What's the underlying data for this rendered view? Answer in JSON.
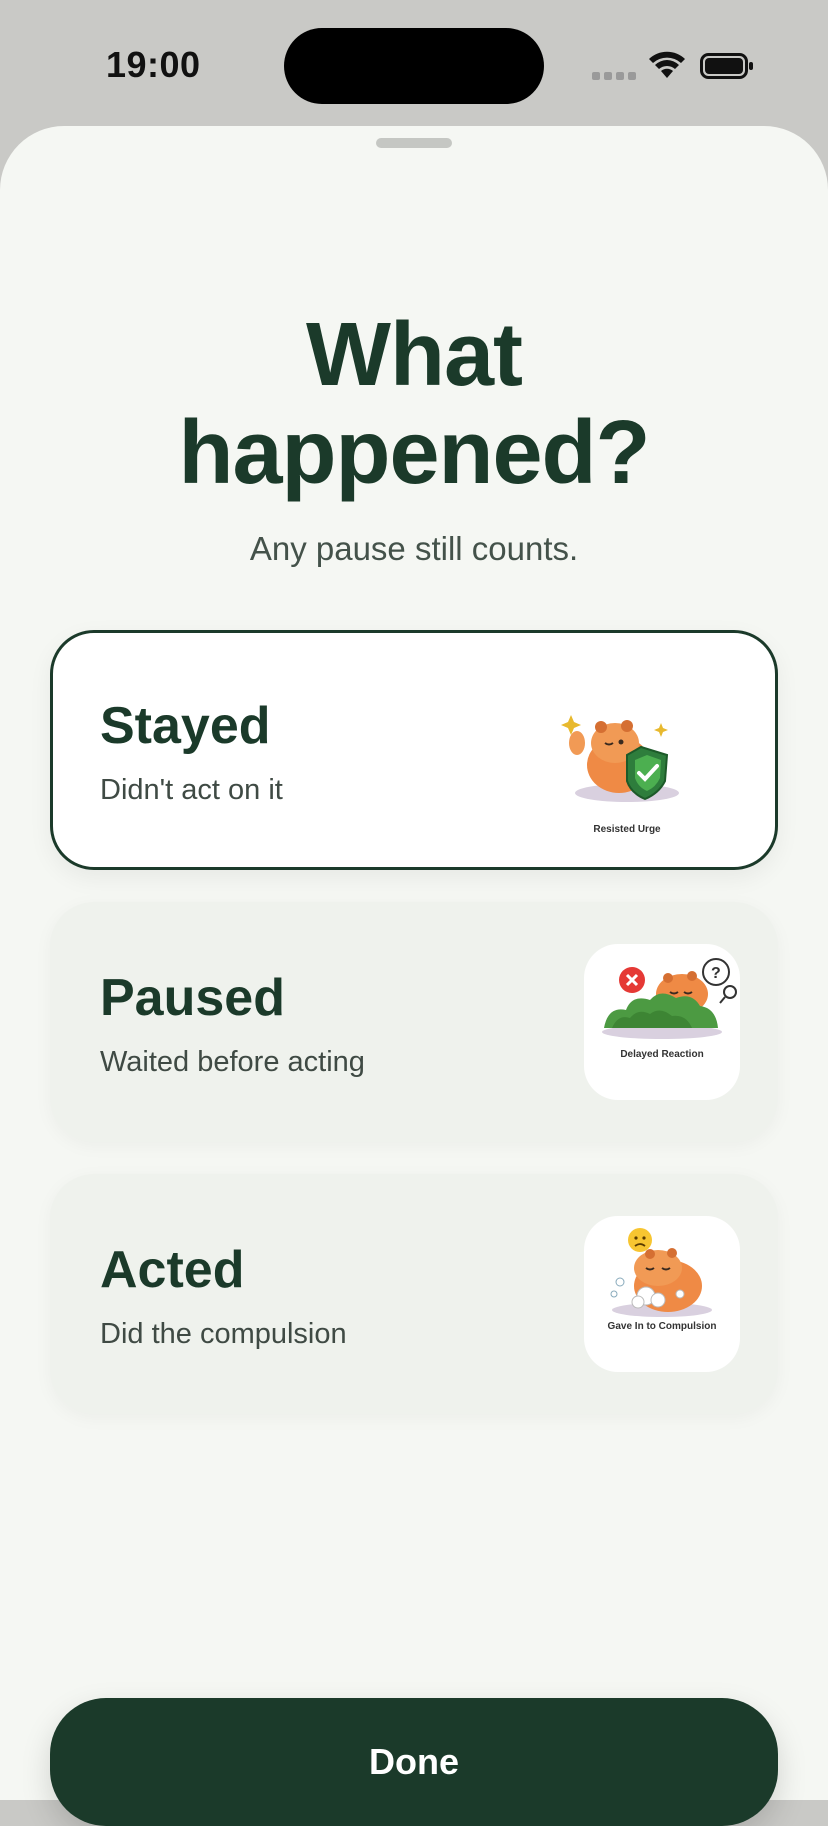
{
  "status_bar": {
    "time": "19:00"
  },
  "header": {
    "title_line1": "What",
    "title_line2": "happened?",
    "subtitle": "Any pause still counts."
  },
  "options": [
    {
      "label": "Stayed",
      "description": "Didn't act on it",
      "sticker_caption": "Resisted Urge",
      "selected": true,
      "icon": "capybara-shield-icon"
    },
    {
      "label": "Paused",
      "description": "Waited before acting",
      "sticker_caption": "Delayed Reaction",
      "selected": false,
      "icon": "capybara-bush-icon"
    },
    {
      "label": "Acted",
      "description": "Did the compulsion",
      "sticker_caption": "Gave In to Compulsion",
      "selected": false,
      "icon": "capybara-washing-icon"
    }
  ],
  "footer": {
    "done_label": "Done"
  },
  "colors": {
    "accent": "#1b3a2a",
    "background": "#f5f7f3",
    "card": "#eff2ed"
  }
}
